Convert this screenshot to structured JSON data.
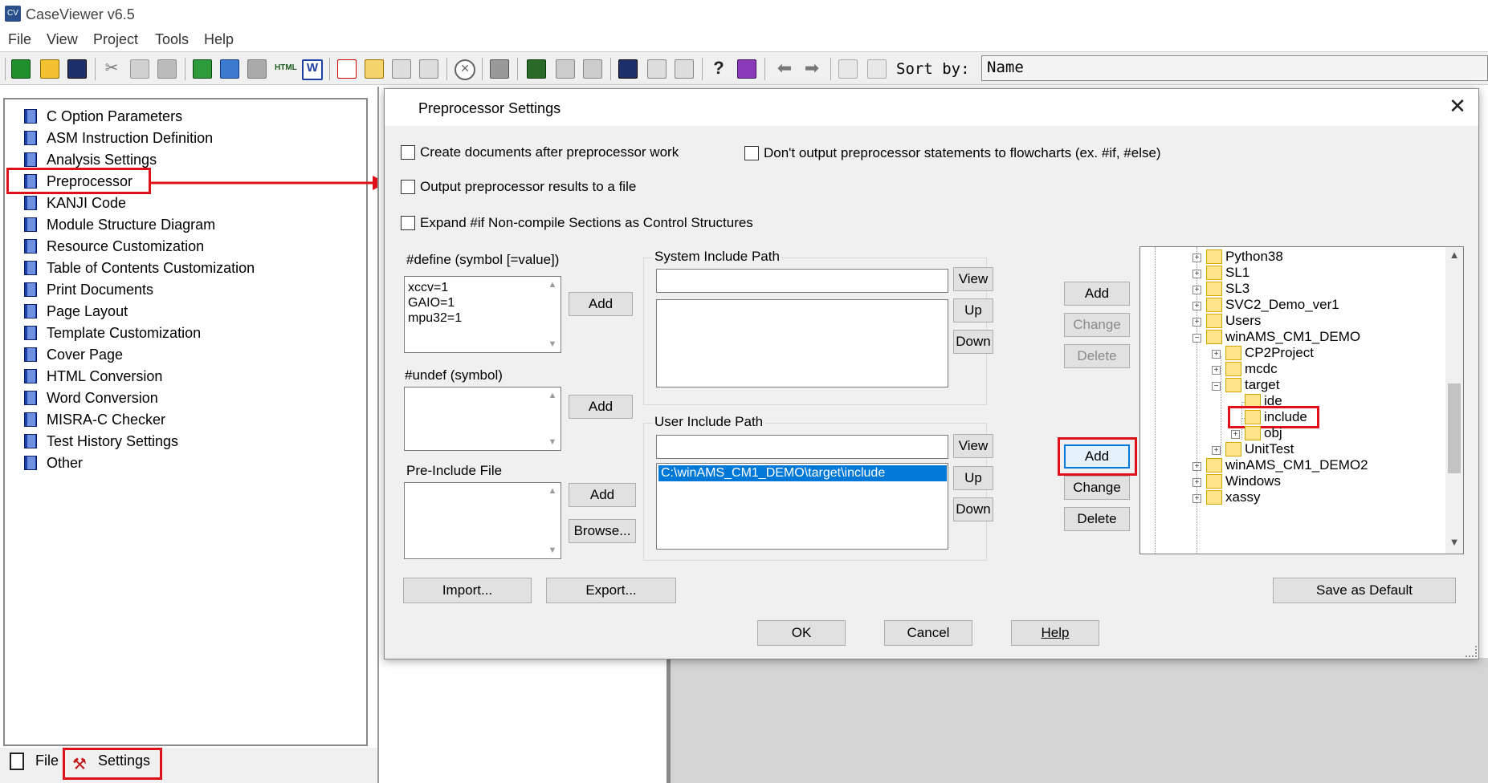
{
  "app": {
    "title": "CaseViewer v6.5",
    "icon": "CV"
  },
  "menu": [
    "File",
    "View",
    "Project",
    "Tools",
    "Help"
  ],
  "toolbar": {
    "sort_label": "Sort by:",
    "sort_value": "Name"
  },
  "settings_list": [
    "C Option Parameters",
    "ASM Instruction Definition",
    "Analysis Settings",
    "Preprocessor",
    "KANJI Code",
    "Module Structure Diagram",
    "Resource Customization",
    "Table of Contents Customization",
    "Print Documents",
    "Page Layout",
    "Template Customization",
    "Cover Page",
    "HTML Conversion",
    "Word Conversion",
    "MISRA-C Checker",
    "Test History Settings",
    "Other"
  ],
  "bottom_tabs": {
    "file": "File",
    "settings": "Settings"
  },
  "dialog": {
    "title": "Preprocessor Settings",
    "close": "✕",
    "checkboxes": {
      "create_docs": "Create documents after preprocessor work",
      "dont_output": "Don't output preprocessor statements to flowcharts (ex. #if, #else)",
      "output_file": "Output preprocessor results to a file",
      "expand_if": "Expand #if Non-compile Sections as Control Structures"
    },
    "define": {
      "label": "#define (symbol [=value])",
      "lines": [
        "xccv=1",
        "GAIO=1",
        "mpu32=1"
      ],
      "add": "Add"
    },
    "undef": {
      "label": "#undef (symbol)",
      "add": "Add"
    },
    "preinclude": {
      "label": "Pre-Include File",
      "add": "Add",
      "browse": "Browse..."
    },
    "system_include": {
      "label": "System Include Path",
      "view": "View",
      "up": "Up",
      "down": "Down",
      "add": "Add",
      "change": "Change",
      "delete": "Delete"
    },
    "user_include": {
      "label": "User Include Path",
      "item": "C:\\winAMS_CM1_DEMO\\target\\include",
      "view": "View",
      "up": "Up",
      "down": "Down",
      "add": "Add",
      "change": "Change",
      "delete": "Delete"
    },
    "tree": [
      "Python38",
      "SL1",
      "SL3",
      "SVC2_Demo_ver1",
      "Users",
      "winAMS_CM1_DEMO",
      "CP2Project",
      "mcdc",
      "target",
      "ide",
      "include",
      "obj",
      "UnitTest",
      "winAMS_CM1_DEMO2",
      "Windows",
      "xassy"
    ],
    "buttons": {
      "import": "Import...",
      "export": "Export...",
      "save_default": "Save as Default",
      "ok": "OK",
      "cancel": "Cancel",
      "help": "Help"
    }
  },
  "colors": {
    "highlight": "#e0101a",
    "selection": "#0078d7"
  }
}
